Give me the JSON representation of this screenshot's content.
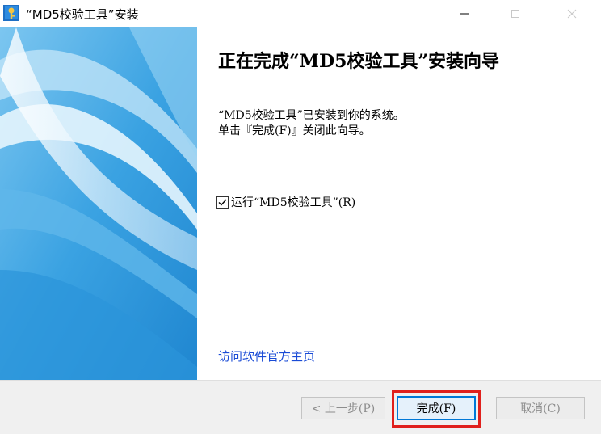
{
  "window": {
    "title": "“MD5校验工具”安装",
    "minimize_icon": "minimize-icon",
    "maximize_icon": "maximize-icon",
    "close_icon": "close-icon"
  },
  "page": {
    "heading": "正在完成“MD5校验工具”安装向导",
    "line1": "“MD5校验工具”已安装到你的系统。",
    "line2": "单击『完成(F)』关闭此向导。",
    "run_checkbox_label": "运行“MD5校验工具”(R)",
    "run_checked": true,
    "homepage_link": "访问软件官方主页"
  },
  "buttons": {
    "back": "< 上一步(P)",
    "finish": "完成(F)",
    "cancel": "取消(C)"
  },
  "colors": {
    "banner_blue": "#3aa6e4",
    "link": "#1a4bd6",
    "highlight": "#e0201c"
  }
}
